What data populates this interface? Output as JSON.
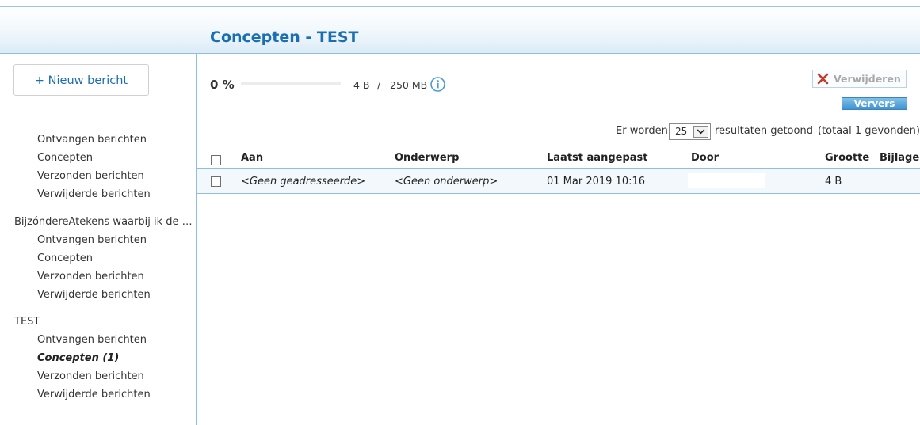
{
  "header": {
    "title": "Concepten - TEST"
  },
  "sidebar": {
    "new_message_label": "+ Nieuw bericht",
    "groups": [
      {
        "title": "",
        "folders": [
          "Ontvangen berichten",
          "Concepten",
          "Verzonden berichten",
          "Verwijderde berichten"
        ]
      },
      {
        "title": "BijzóndereAtekens waarbij ik de n…",
        "folders": [
          "Ontvangen berichten",
          "Concepten",
          "Verzonden berichten",
          "Verwijderde berichten"
        ]
      },
      {
        "title": "TEST",
        "folders": [
          "Ontvangen berichten",
          "Concepten (1)",
          "Verzonden berichten",
          "Verwijderde berichten"
        ],
        "active_folder": "Concepten (1)"
      }
    ]
  },
  "quota": {
    "percent_label": "0 %",
    "fill_fraction": 0.0,
    "used": "4 B",
    "separator": "/",
    "total": "250 MB",
    "info_icon": "info-icon"
  },
  "toolbar": {
    "delete_label": "Verwijderen",
    "delete_icon": "delete-x-icon",
    "refresh_label": "Ververs"
  },
  "results": {
    "prefix": "Er worden",
    "page_size": "25",
    "suffix": "resultaten getoond",
    "total": "(totaal 1 gevonden)"
  },
  "table": {
    "columns": [
      "Aan",
      "Onderwerp",
      "Laatst aangepast",
      "Door",
      "Grootte",
      "Bijlage"
    ],
    "rows": [
      {
        "to": "<Geen geadresseerde>",
        "subject": "<Geen onderwerp>",
        "modified": "01 Mar 2019 10:16",
        "by": "",
        "size": "4 B",
        "attachment": ""
      }
    ]
  },
  "colors": {
    "accent": "#1a6fb0",
    "border": "#8fbfdf",
    "row_bg": "#f3f8fc",
    "button_blue": "#3f93d1",
    "delete_red": "#c0392b"
  }
}
